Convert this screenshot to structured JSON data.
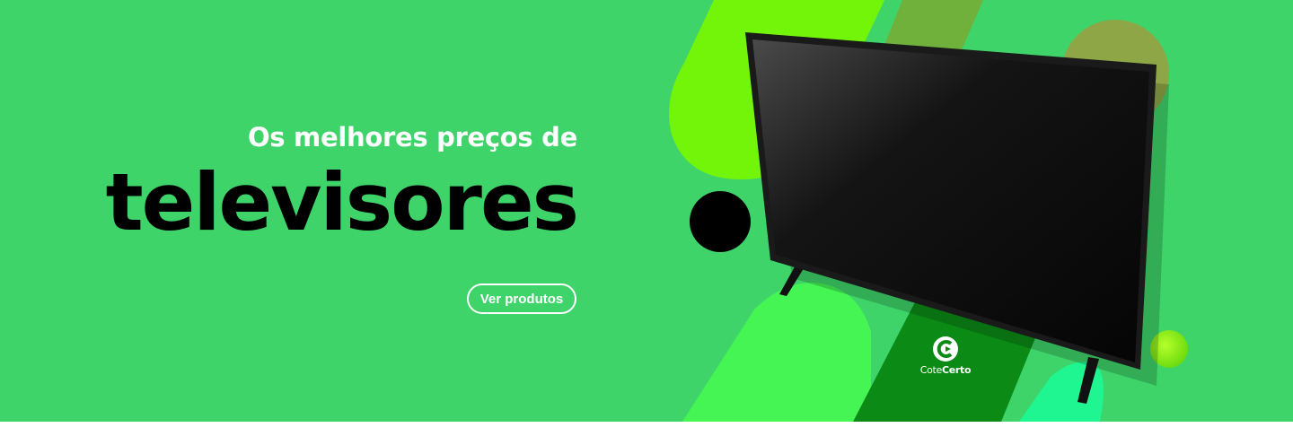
{
  "banner": {
    "headline": "Os melhores preços de",
    "title": "televisores",
    "cta_label": "Ver produtos",
    "logo": {
      "text_light": "Cote",
      "text_bold": "Certo"
    },
    "product_image": "television",
    "colors": {
      "background": "#3ed46a",
      "lime": "#73f50a",
      "olive": "#6fb13a",
      "bright_green": "#44f554",
      "dark_green": "#0b8a16",
      "mint": "#1ff590",
      "black": "#000000",
      "white": "#ffffff"
    }
  }
}
